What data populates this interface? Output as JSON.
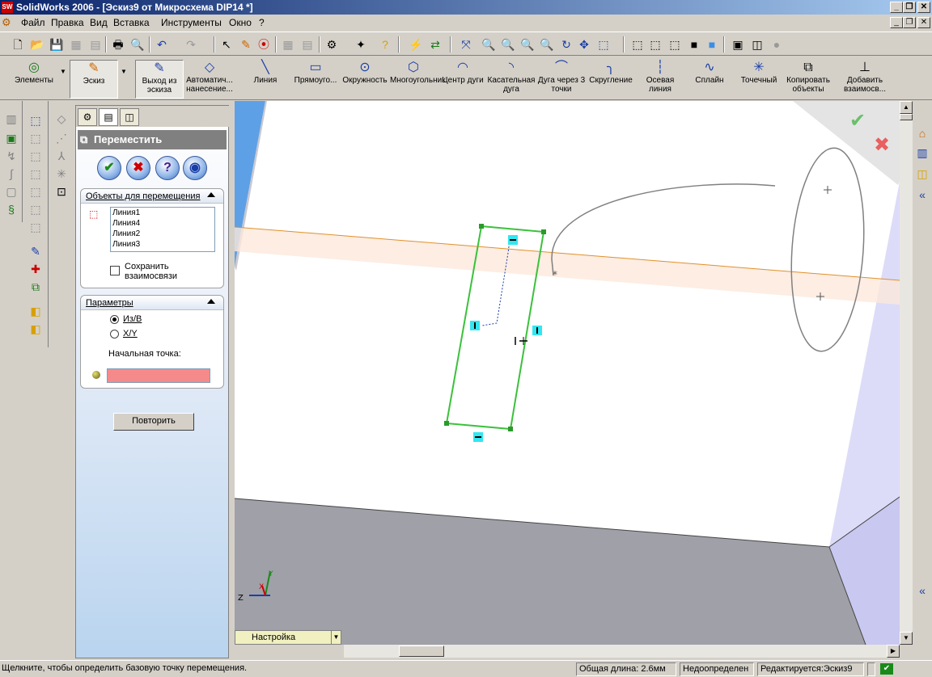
{
  "window": {
    "title": "SolidWorks 2006 - [Эскиз9 от Микросхема DIP14 *]"
  },
  "menu": [
    "Файл",
    "Правка",
    "Вид",
    "Вставка",
    "Инструменты",
    "Окно",
    "?"
  ],
  "command_manager": {
    "left_buttons": [
      {
        "label": "Элементы",
        "icon": "features-icon"
      },
      {
        "label": "Эскиз",
        "icon": "sketch-icon"
      }
    ],
    "tools": [
      {
        "label": "Выход из эскиза",
        "icon": "exit-sketch-icon"
      },
      {
        "label": "Автоматич... нанесение...",
        "icon": "smart-dimension-icon"
      },
      {
        "label": "Линия",
        "icon": "line-icon"
      },
      {
        "label": "Прямоуго...",
        "icon": "rectangle-icon"
      },
      {
        "label": "Окружность",
        "icon": "circle-icon"
      },
      {
        "label": "Многоугольник",
        "icon": "polygon-icon"
      },
      {
        "label": "Центр дуги",
        "icon": "center-arc-icon"
      },
      {
        "label": "Касательная дуга",
        "icon": "tangent-arc-icon"
      },
      {
        "label": "Дуга через 3 точки",
        "icon": "three-point-arc-icon"
      },
      {
        "label": "Скругление",
        "icon": "fillet-icon"
      },
      {
        "label": "Осевая линия",
        "icon": "centerline-icon"
      },
      {
        "label": "Сплайн",
        "icon": "spline-icon"
      },
      {
        "label": "Точечный",
        "icon": "point-icon"
      },
      {
        "label": "Копировать объекты",
        "icon": "copy-entities-icon"
      },
      {
        "label": "Добавить взаимосв...",
        "icon": "add-relation-icon"
      }
    ]
  },
  "property_manager": {
    "title": "Переместить",
    "objects_group": {
      "title": "Объекты для перемещения",
      "items": [
        "Линия1",
        "Линия4",
        "Линия2",
        "Линия3"
      ],
      "keep_relations_label": "Сохранить взаимосвязи",
      "keep_relations_checked": false
    },
    "params_group": {
      "title": "Параметры",
      "option_from_to": "Из/В",
      "option_xy": "X/Y",
      "selected": "Из/В",
      "start_point_label": "Начальная точка:",
      "start_point_value": ""
    },
    "repeat_button": "Повторить"
  },
  "graphics": {
    "config_dropdown": "Настройка",
    "axis_labels": {
      "x": "X",
      "y": "Y",
      "z": "Z"
    }
  },
  "statusbar": {
    "message": "Щелкните, чтобы определить базовую точку перемещения.",
    "length": "Общая длина: 2.6мм",
    "state": "Недоопределен",
    "editing": "Редактируется:Эскиз9"
  }
}
